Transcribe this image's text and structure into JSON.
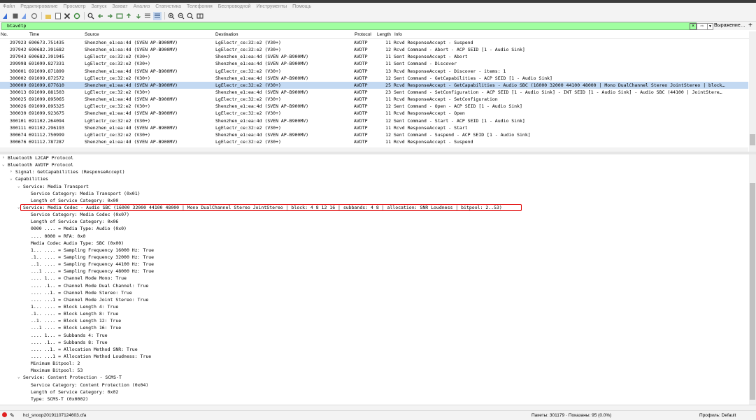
{
  "menu": [
    "Файл",
    "Редактирование",
    "Просмотр",
    "Запуск",
    "Захват",
    "Анализ",
    "Статистика",
    "Телефония",
    "Беспроводной",
    "Инструменты",
    "Помощь"
  ],
  "filter": {
    "value": "btavdtp",
    "expression_label": "Выражение…",
    "plus": "+"
  },
  "columns": {
    "no": "No.",
    "time": "Time",
    "source": "Source",
    "destination": "Destination",
    "protocol": "Protocol",
    "length": "Length",
    "info": "Info"
  },
  "packets": [
    {
      "no": "297923",
      "time": "690673.751435",
      "src": "Shenzhen_e1:ea:4d (SVEN AP-B900MV)",
      "dst": "LgElectr_ce:32:e2 (V30+)",
      "proto": "AVDTP",
      "len": "11",
      "info": "Rcvd ResponseAccept - Suspend"
    },
    {
      "no": "297942",
      "time": "690682.391682",
      "src": "Shenzhen_e1:ea:4d (SVEN AP-B900MV)",
      "dst": "LgElectr_ce:32:e2 (V30+)",
      "proto": "AVDTP",
      "len": "12",
      "info": "Rcvd Command - Abort - ACP SEID [1 - Audio Sink]"
    },
    {
      "no": "297943",
      "time": "690682.391945",
      "src": "LgElectr_ce:32:e2 (V30+)",
      "dst": "Shenzhen_e1:ea:4d (SVEN AP-B900MV)",
      "proto": "AVDTP",
      "len": "11",
      "info": "Sent ResponseAccept - Abort"
    },
    {
      "no": "299998",
      "time": "691099.827331",
      "src": "LgElectr_ce:32:e2 (V30+)",
      "dst": "Shenzhen_e1:ea:4d (SVEN AP-B900MV)",
      "proto": "AVDTP",
      "len": "11",
      "info": "Sent Command - Discover"
    },
    {
      "no": "300001",
      "time": "691099.871899",
      "src": "Shenzhen_e1:ea:4d (SVEN AP-B900MV)",
      "dst": "LgElectr_ce:32:e2 (V30+)",
      "proto": "AVDTP",
      "len": "13",
      "info": "Rcvd ResponseAccept - Discover - items: 1"
    },
    {
      "no": "300002",
      "time": "691099.872572",
      "src": "LgElectr_ce:32:e2 (V30+)",
      "dst": "Shenzhen_e1:ea:4d (SVEN AP-B900MV)",
      "proto": "AVDTP",
      "len": "12",
      "info": "Sent Command - GetCapabilities - ACP SEID [1 - Audio Sink]"
    },
    {
      "no": "300009",
      "time": "691099.877610",
      "src": "Shenzhen_e1:ea:4d (SVEN AP-B900MV)",
      "dst": "LgElectr_ce:32:e2 (V30+)",
      "proto": "AVDTP",
      "len": "25",
      "info": "Rcvd ResponseAccept - GetCapabilities - Audio SBC (16000 32000 44100 48000 | Mono DualChannel Stereo JointStereo | block…",
      "selected": true
    },
    {
      "no": "300013",
      "time": "691099.881503",
      "src": "LgElectr_ce:32:e2 (V30+)",
      "dst": "Shenzhen_e1:ea:4d (SVEN AP-B900MV)",
      "proto": "AVDTP",
      "len": "23",
      "info": "Sent Command - SetConfiguration - ACP SEID [1 - Audio Sink] - INT SEID [1 - Audio Sink] - Audio SBC (44100 | JointStere…"
    },
    {
      "no": "300025",
      "time": "691099.895065",
      "src": "Shenzhen_e1:ea:4d (SVEN AP-B900MV)",
      "dst": "LgElectr_ce:32:e2 (V30+)",
      "proto": "AVDTP",
      "len": "11",
      "info": "Rcvd ResponseAccept - SetConfiguration"
    },
    {
      "no": "300026",
      "time": "691099.895325",
      "src": "LgElectr_ce:32:e2 (V30+)",
      "dst": "Shenzhen_e1:ea:4d (SVEN AP-B900MV)",
      "proto": "AVDTP",
      "len": "12",
      "info": "Sent Command - Open - ACP SEID [1 - Audio Sink]"
    },
    {
      "no": "300030",
      "time": "691099.923675",
      "src": "Shenzhen_e1:ea:4d (SVEN AP-B900MV)",
      "dst": "LgElectr_ce:32:e2 (V30+)",
      "proto": "AVDTP",
      "len": "11",
      "info": "Rcvd ResponseAccept - Open"
    },
    {
      "no": "300101",
      "time": "691102.264094",
      "src": "LgElectr_ce:32:e2 (V30+)",
      "dst": "Shenzhen_e1:ea:4d (SVEN AP-B900MV)",
      "proto": "AVDTP",
      "len": "12",
      "info": "Sent Command - Start - ACP SEID [1 - Audio Sink]"
    },
    {
      "no": "300111",
      "time": "691102.296193",
      "src": "Shenzhen_e1:ea:4d (SVEN AP-B900MV)",
      "dst": "LgElectr_ce:32:e2 (V30+)",
      "proto": "AVDTP",
      "len": "11",
      "info": "Rcvd ResponseAccept - Start"
    },
    {
      "no": "300674",
      "time": "691112.750999",
      "src": "LgElectr_ce:32:e2 (V30+)",
      "dst": "Shenzhen_e1:ea:4d (SVEN AP-B900MV)",
      "proto": "AVDTP",
      "len": "12",
      "info": "Sent Command - Suspend - ACP SEID [1 - Audio Sink]"
    },
    {
      "no": "300676",
      "time": "691112.787287",
      "src": "Shenzhen_e1:ea:4d (SVEN AP-B900MV)",
      "dst": "LgElectr_ce:32:e2 (V30+)",
      "proto": "AVDTP",
      "len": "11",
      "info": "Rcvd ResponseAccept - Suspend"
    }
  ],
  "details": [
    {
      "lvl": 0,
      "tog": ">",
      "text": "Bluetooth L2CAP Protocol"
    },
    {
      "lvl": 0,
      "tog": "v",
      "text": "Bluetooth AVDTP Protocol"
    },
    {
      "lvl": 1,
      "tog": ">",
      "text": "Signal: GetCapabilities (ResponseAccept)"
    },
    {
      "lvl": 1,
      "tog": "v",
      "text": "Capabilities"
    },
    {
      "lvl": 2,
      "tog": "v",
      "text": "Service: Media Transport"
    },
    {
      "lvl": 3,
      "tog": "",
      "text": "Service Category: Media Transport (0x01)"
    },
    {
      "lvl": 3,
      "tog": "",
      "text": "Length of Service Category: 0x00"
    },
    {
      "lvl": 2,
      "tog": "v",
      "text": "Service: Media Codec - Audio SBC (16000 32000 44100 48000 | Mono DualChannel Stereo JointStereo | block: 4 8 12 16 | subbands: 4 8 | allocation: SNR Loudness | bitpool: 2..53)"
    },
    {
      "lvl": 3,
      "tog": "",
      "text": "Service Category: Media Codec (0x07)"
    },
    {
      "lvl": 3,
      "tog": "",
      "text": "Length of Service Category: 0x06"
    },
    {
      "lvl": 3,
      "tog": "",
      "text": "0000 .... = Media Type: Audio (0x0)"
    },
    {
      "lvl": 3,
      "tog": "",
      "text": ".... 0000 = RFA: 0x0"
    },
    {
      "lvl": 3,
      "tog": "",
      "text": "Media Codec Audio Type: SBC (0x00)"
    },
    {
      "lvl": 3,
      "tog": "",
      "text": "1... .... = Sampling Frequency 16000 Hz: True"
    },
    {
      "lvl": 3,
      "tog": "",
      "text": ".1.. .... = Sampling Frequency 32000 Hz: True"
    },
    {
      "lvl": 3,
      "tog": "",
      "text": "..1. .... = Sampling Frequency 44100 Hz: True"
    },
    {
      "lvl": 3,
      "tog": "",
      "text": "...1 .... = Sampling Frequency 48000 Hz: True"
    },
    {
      "lvl": 3,
      "tog": "",
      "text": ".... 1... = Channel Mode Mono: True"
    },
    {
      "lvl": 3,
      "tog": "",
      "text": ".... .1.. = Channel Mode Dual Channel: True"
    },
    {
      "lvl": 3,
      "tog": "",
      "text": ".... ..1. = Channel Mode Stereo: True"
    },
    {
      "lvl": 3,
      "tog": "",
      "text": ".... ...1 = Channel Mode Joint Stereo: True"
    },
    {
      "lvl": 3,
      "tog": "",
      "text": "1... .... = Block Length 4: True"
    },
    {
      "lvl": 3,
      "tog": "",
      "text": ".1.. .... = Block Length 8: True"
    },
    {
      "lvl": 3,
      "tog": "",
      "text": "..1. .... = Block Length 12: True"
    },
    {
      "lvl": 3,
      "tog": "",
      "text": "...1 .... = Block Length 16: True"
    },
    {
      "lvl": 3,
      "tog": "",
      "text": ".... 1... = Subbands 4: True"
    },
    {
      "lvl": 3,
      "tog": "",
      "text": ".... .1.. = Subbands 8: True"
    },
    {
      "lvl": 3,
      "tog": "",
      "text": ".... ..1. = Allocation Method SNR: True"
    },
    {
      "lvl": 3,
      "tog": "",
      "text": ".... ...1 = Allocation Method Loudness: True"
    },
    {
      "lvl": 3,
      "tog": "",
      "text": "Minimum Bitpool: 2"
    },
    {
      "lvl": 3,
      "tog": "",
      "text": "Maximum Bitpool: 53"
    },
    {
      "lvl": 2,
      "tog": "v",
      "text": "Service: Content Protection - SCMS-T"
    },
    {
      "lvl": 3,
      "tog": "",
      "text": "Service Category: Content Protection (0x04)"
    },
    {
      "lvl": 3,
      "tog": "",
      "text": "Length of Service Category: 0x02"
    },
    {
      "lvl": 3,
      "tog": "",
      "text": "Type: SCMS-T (0x0002)"
    }
  ],
  "status": {
    "file": "hci_snoop20191107124603.cfa",
    "counts": "Пакеты: 301179 · Показаны: 95 (0.0%)",
    "profile": "Профиль: Default"
  },
  "colors": {
    "filter_ok": "#a0ffa0",
    "selected_row": "#c3d9f2",
    "highlight_box": "#e00000"
  }
}
